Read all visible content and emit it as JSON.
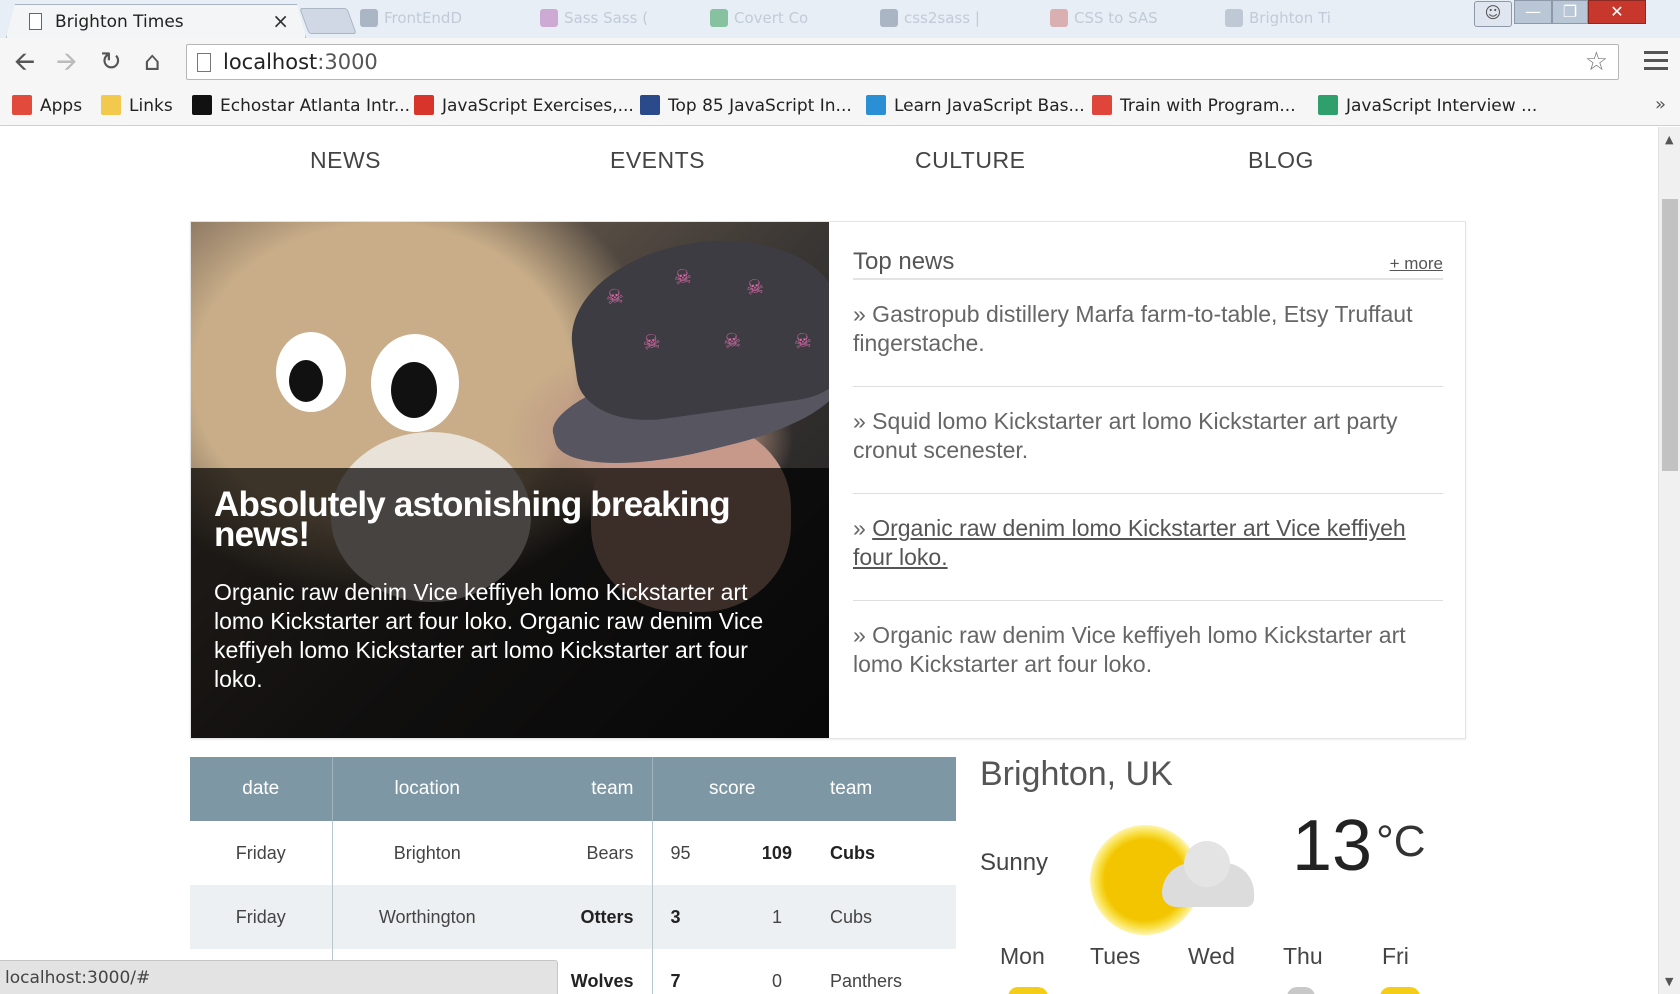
{
  "browser": {
    "active_tab": {
      "title": "Brighton Times",
      "close": "×"
    },
    "bg_tabs": [
      {
        "label": "FrontEndD",
        "color": "#9aa7b6"
      },
      {
        "label": "Sass Sass (",
        "color": "#c79acb"
      },
      {
        "label": "Covert Co",
        "color": "#6fb88b"
      },
      {
        "label": "css2sass |",
        "color": "#9aa7b6"
      },
      {
        "label": "CSS to SAS",
        "color": "#d7a0a0"
      },
      {
        "label": "Brighton Ti",
        "color": "#b6c1cf"
      }
    ],
    "url_host": "localhost",
    "url_port": ":3000",
    "bookmarks": [
      {
        "label": "Apps",
        "icon": "apps-grid-icon",
        "color": "#e24a3b"
      },
      {
        "label": "Links",
        "icon": "folder-icon",
        "color": "#f2c94c"
      },
      {
        "label": "Echostar Atlanta Intr...",
        "icon": "s-logo-icon",
        "color": "#111111"
      },
      {
        "label": "JavaScript Exercises,...",
        "icon": "w3resource-icon",
        "color": "#d9342b"
      },
      {
        "label": "Top 85 JavaScript In...",
        "icon": "g-logo-icon",
        "color": "#2b4a8c"
      },
      {
        "label": "Learn JavaScript Bas...",
        "icon": "code-brackets-icon",
        "color": "#2b8fd6"
      },
      {
        "label": "Train with Program...",
        "icon": "codewars-icon",
        "color": "#e0453b"
      },
      {
        "label": "JavaScript Interview ...",
        "icon": "question-icon",
        "color": "#2fa06b"
      }
    ],
    "bookmarks_more": "»",
    "status_url": "localhost:3000/#"
  },
  "page": {
    "nav": [
      "NEWS",
      "EVENTS",
      "CULTURE",
      "BLOG"
    ],
    "hero": {
      "headline": "Absolutely astonishing breaking news!",
      "lede": "Organic raw denim Vice keffiyeh lomo Kickstarter art lomo Kickstarter art four loko. Organic raw denim Vice keffiyeh lomo Kickstarter art lomo Kickstarter art four loko."
    },
    "top_news": {
      "title": "Top news",
      "more": "+ more",
      "items": [
        "» Gastropub distillery Marfa farm-to-table, Etsy Truffaut fingerstache.",
        "» Squid lomo Kickstarter art lomo Kickstarter art party cronut scenester.",
        "Organic raw denim lomo Kickstarter art Vice keffiyeh four loko.",
        "» Organic raw denim Vice keffiyeh lomo Kickstarter art lomo Kickstarter art four loko."
      ],
      "link_prefix": "» "
    },
    "scores": {
      "headers": [
        "date",
        "location",
        "team",
        "score",
        "team"
      ],
      "rows": [
        {
          "date": "Friday",
          "location": "Brighton",
          "team1": "Bears",
          "s1": "95",
          "s2": "109",
          "team2": "Cubs"
        },
        {
          "date": "Friday",
          "location": "Worthington",
          "team1": "Otters",
          "s1": "3",
          "s2": "1",
          "team2": "Cubs"
        },
        {
          "date": "",
          "location": "",
          "team1": "Wolves",
          "s1": "7",
          "s2": "0",
          "team2": "Panthers"
        }
      ]
    },
    "weather": {
      "city": "Brighton, UK",
      "condition": "Sunny",
      "temp": "13",
      "unit": "°C",
      "days": [
        "Mon",
        "Tues",
        "Wed",
        "Thu",
        "Fri"
      ]
    }
  }
}
